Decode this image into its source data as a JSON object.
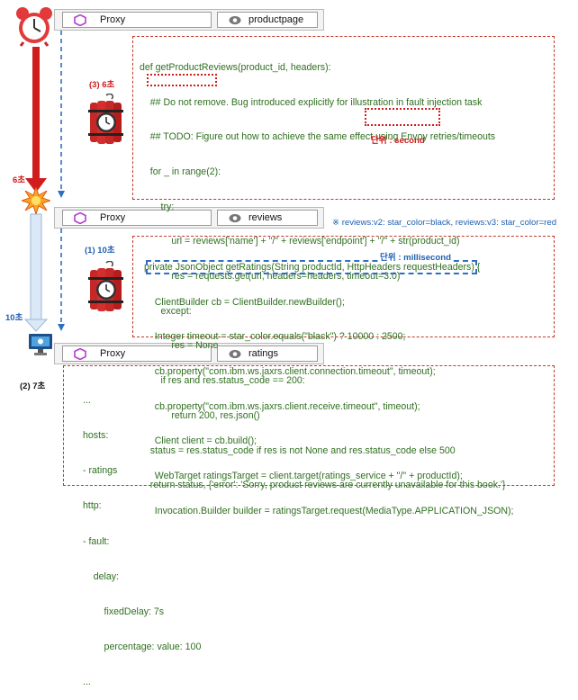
{
  "colors": {
    "code": "#2f6f1f",
    "red": "#d01c1c",
    "blue": "#1f5fb0",
    "box": "#c0392b",
    "gray_bar": "#f3f3f3",
    "hex_icon": "#b43ecf"
  },
  "icons": {
    "timer": "alarm-clock-icon",
    "bomb": "time-bomb-icon",
    "blast": "explosion-icon",
    "monitor": "monitor-icon",
    "service": "hexagon-icon",
    "eye": "eye-icon"
  },
  "services": [
    {
      "proxy": "Proxy",
      "name": "productpage"
    },
    {
      "proxy": "Proxy",
      "name": "reviews"
    },
    {
      "proxy": "Proxy",
      "name": "ratings"
    }
  ],
  "timeline": {
    "top_label": "6초",
    "bottom_label": "10초"
  },
  "step_labels": {
    "step3": "(3) 6초",
    "step1": "(1) 10초",
    "step2": "(2) 7초"
  },
  "notes": {
    "reviews_note": "※ reviews:v2: star_color=black, reviews:v3: star_color=red",
    "unit_second": "단위 : second",
    "unit_ms": "단위 : millisecond"
  },
  "productpage_code": [
    "def getProductReviews(product_id, headers):",
    "    ## Do not remove. Bug introduced explicitly for illustration in fault injection task",
    "    ## TODO: Figure out how to achieve the same effect using Envoy retries/timeouts",
    "    for _ in range(2):",
    "        try:",
    "            url = reviews['name'] + \"/\" + reviews['endpoint'] + \"/\" + str(product_id)",
    "            res = requests.get(url, headers=headers, timeout=3.0)",
    "        except:",
    "            res = None",
    "        if res and res.status_code == 200:",
    "            return 200, res.json()",
    "    status = res.status_code if res is not None and res.status_code else 500",
    "    return status, {'error': 'Sorry, product reviews are currently unavailable for this book.'}"
  ],
  "reviews_code": [
    "private JsonObject getRatings(String productId, HttpHeaders requestHeaders) {",
    "    ClientBuilder cb = ClientBuilder.newBuilder();",
    "    Integer timeout = star_color.equals(\"black\") ? 10000 : 2500;",
    "    cb.property(\"com.ibm.ws.jaxrs.client.connection.timeout\", timeout);",
    "    cb.property(\"com.ibm.ws.jaxrs.client.receive.timeout\", timeout);",
    "    Client client = cb.build();",
    "    WebTarget ratingsTarget = client.target(ratings_service + \"/\" + productId);",
    "    Invocation.Builder builder = ratingsTarget.request(MediaType.APPLICATION_JSON);"
  ],
  "fault_config": [
    "...",
    "hosts:",
    "- ratings",
    "http:",
    "- fault:",
    "    delay:",
    "        fixedDelay: 7s",
    "        percentage: value: 100",
    "..."
  ]
}
